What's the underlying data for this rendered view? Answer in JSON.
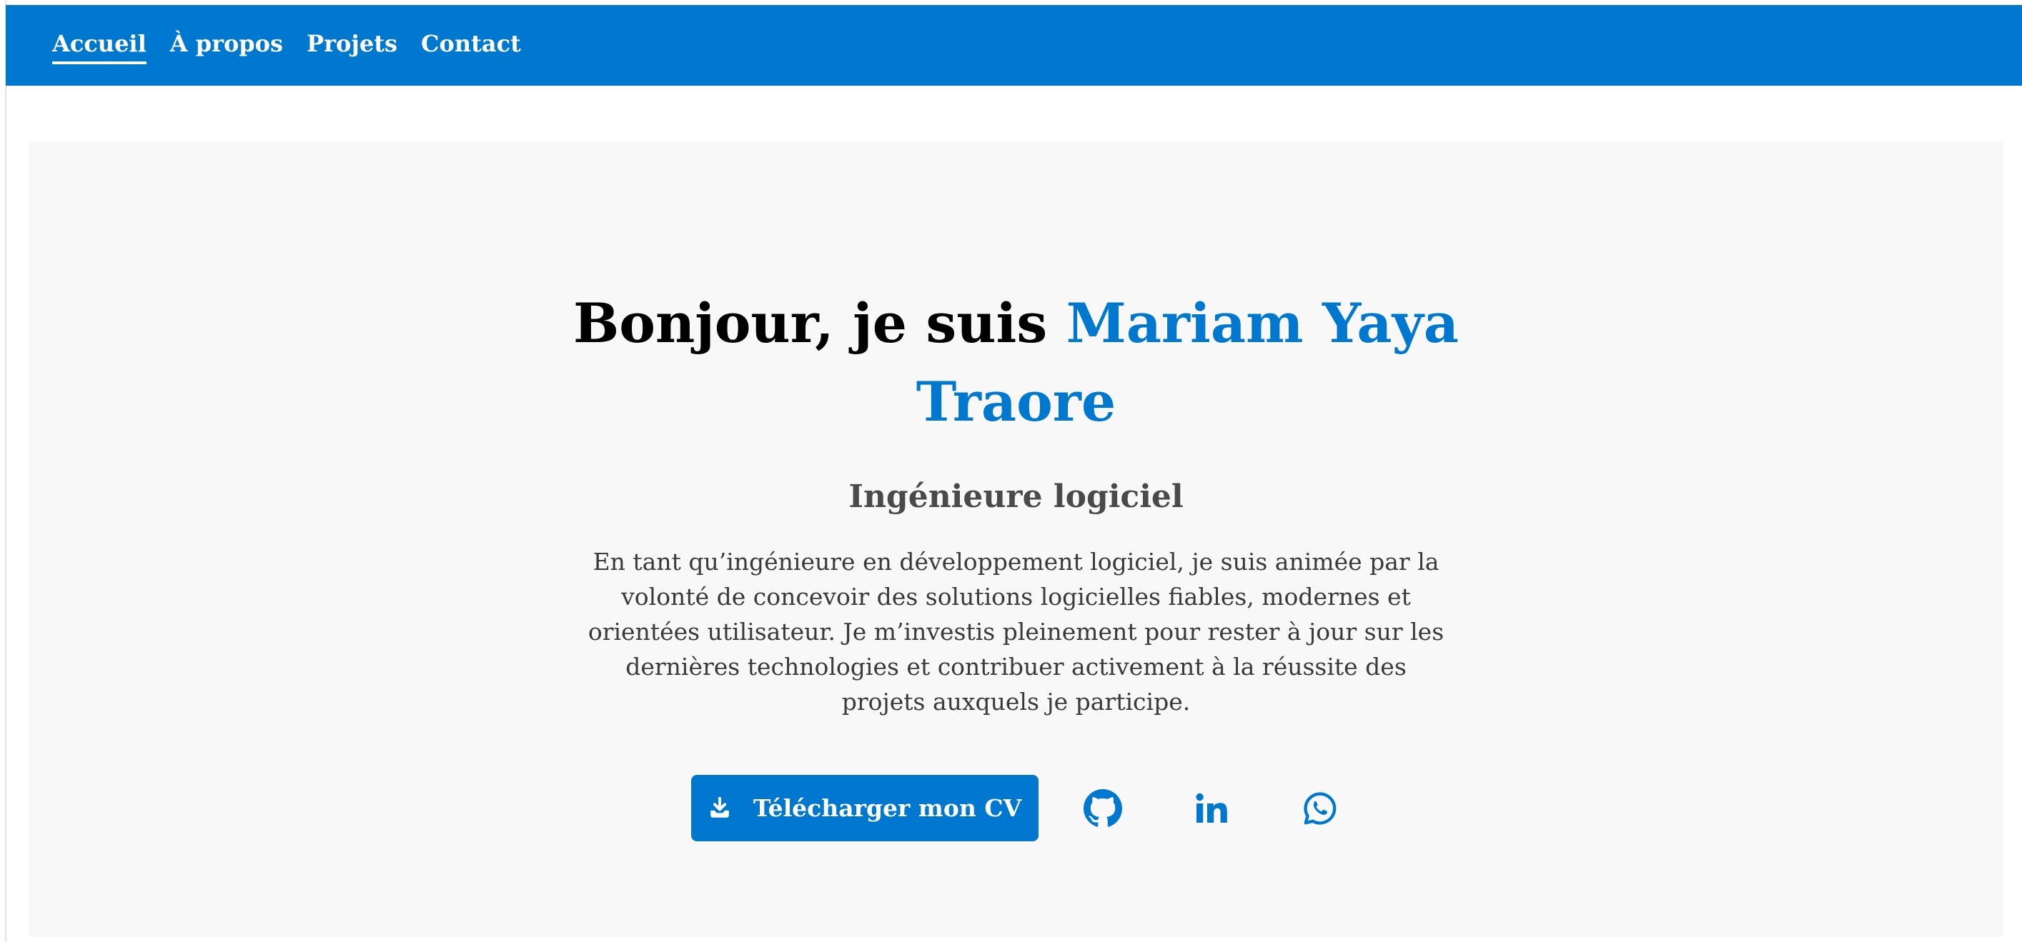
{
  "nav": {
    "items": [
      {
        "label": "Accueil",
        "active": true
      },
      {
        "label": "À propos",
        "active": false
      },
      {
        "label": "Projets",
        "active": false
      },
      {
        "label": "Contact",
        "active": false
      }
    ]
  },
  "hero": {
    "greeting": "Bonjour, je suis ",
    "name": "Mariam Yaya Traore",
    "subtitle": "Ingénieure logiciel",
    "description": "En tant qu’ingénieure en développement logiciel, je suis animée par la volonté de concevoir des solutions logicielles fiables, modernes et orientées utilisateur. Je m’investis pleinement pour rester à jour sur les dernières technologies et contribuer activement à la réussite des projets auxquels je participe.",
    "cv_button_label": "Télécharger mon CV",
    "cv_button_icon": "download-icon",
    "social": [
      {
        "icon": "github-icon"
      },
      {
        "icon": "linkedin-icon"
      },
      {
        "icon": "whatsapp-icon"
      }
    ]
  },
  "colors": {
    "primary": "#0078cf",
    "nav_text": "#ffffff",
    "hero_bg": "#f8f8f8",
    "title_text": "#000000",
    "subtitle_text": "#4a4a4a",
    "body_text": "#3a3a3a"
  }
}
